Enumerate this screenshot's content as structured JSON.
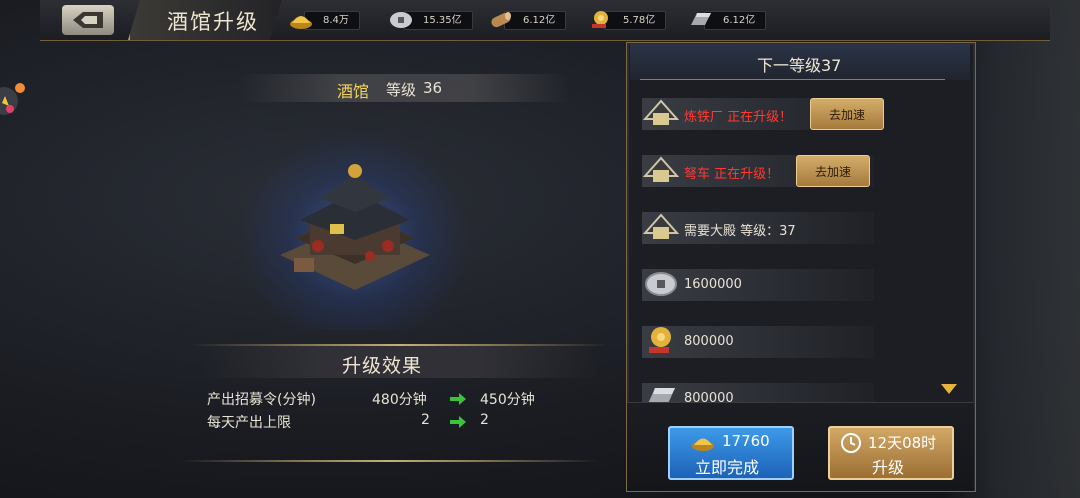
{
  "topbar": {
    "title": "酒馆升级",
    "resources": [
      {
        "icon": "gold-ingot-icon",
        "value": "8.4万"
      },
      {
        "icon": "silver-coin-icon",
        "value": "15.35亿"
      },
      {
        "icon": "wood-log-icon",
        "value": "6.12亿"
      },
      {
        "icon": "grain-icon",
        "value": "5.78亿"
      },
      {
        "icon": "iron-bar-icon",
        "value": "6.12亿"
      }
    ]
  },
  "building": {
    "name": "酒馆",
    "level_label": "等级",
    "level": "36"
  },
  "effects": {
    "title": "升级效果",
    "rows": [
      {
        "label": "产出招募令(分钟)",
        "current": "480分钟",
        "next": "450分钟"
      },
      {
        "label": "每天产出上限",
        "current": "2",
        "next": "2"
      }
    ]
  },
  "next_level": {
    "title": "下一等级37",
    "requirements": [
      {
        "icon": "building-icon",
        "text": "炼铁厂 正在升级！",
        "status": "red",
        "button": "去加速"
      },
      {
        "icon": "building-icon",
        "text": "弩车 正在升级！",
        "status": "red",
        "button": "去加速"
      },
      {
        "icon": "building-icon",
        "text": "需要大殿 等级：37",
        "status": "white"
      },
      {
        "icon": "silver-coin-icon",
        "text": "1600000",
        "status": "white"
      },
      {
        "icon": "grain-icon",
        "text": "800000",
        "status": "white"
      },
      {
        "icon": "iron-bar-icon",
        "text": "800000",
        "status": "white"
      }
    ]
  },
  "actions": {
    "complete_cost": "17760",
    "complete_label": "立即完成",
    "upgrade_time": "12天08时",
    "upgrade_label": "升级"
  },
  "colors": {
    "accent_gold": "#e6b43c",
    "alert_red": "#ff3b30",
    "complete_blue": "#2f80d6",
    "upgrade_bronze": "#b8874a"
  }
}
